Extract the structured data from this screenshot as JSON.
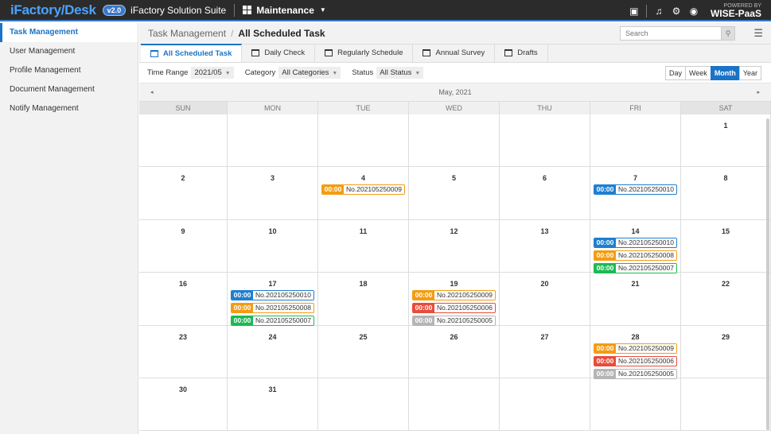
{
  "topbar": {
    "brand_part1": "iFactory",
    "brand_slash": "/",
    "brand_part2": "Desk",
    "version": "v2.0",
    "suite": "iFactory Solution Suite",
    "module": "Maintenance",
    "powered_by": "POWERED BY",
    "wise": "WISE-PaaS"
  },
  "sidebar": {
    "items": [
      {
        "label": "Task Management"
      },
      {
        "label": "User Management"
      },
      {
        "label": "Profile Management"
      },
      {
        "label": "Document Management"
      },
      {
        "label": "Notify Management"
      }
    ]
  },
  "breadcrumb": {
    "parent": "Task Management",
    "separator": "/",
    "current": "All Scheduled Task"
  },
  "search": {
    "placeholder": "Search"
  },
  "tabs": [
    {
      "label": "All Scheduled Task"
    },
    {
      "label": "Daily Check"
    },
    {
      "label": "Regularly Schedule"
    },
    {
      "label": "Annual Survey"
    },
    {
      "label": "Drafts"
    }
  ],
  "filters": {
    "time_range_label": "Time Range",
    "time_range_value": "2021/05",
    "category_label": "Category",
    "category_value": "All Categories",
    "status_label": "Status",
    "status_value": "All Status"
  },
  "views": [
    "Day",
    "Week",
    "Month",
    "Year"
  ],
  "calendar": {
    "month_label": "May, 2021",
    "prev_icon": "◂",
    "next_icon": "▸",
    "weekdays": [
      "SUN",
      "MON",
      "TUE",
      "WED",
      "THU",
      "FRI",
      "SAT"
    ],
    "colors": {
      "blue": "#1e7fd0",
      "orange": "#f39c12",
      "green": "#1db954",
      "red": "#e74c3c",
      "gray": "#b5b5b5"
    },
    "weeks": [
      [
        {
          "day": ""
        },
        {
          "day": ""
        },
        {
          "day": ""
        },
        {
          "day": ""
        },
        {
          "day": ""
        },
        {
          "day": ""
        },
        {
          "day": "1"
        }
      ],
      [
        {
          "day": "2"
        },
        {
          "day": "3"
        },
        {
          "day": "4",
          "events": [
            {
              "time": "00:00",
              "no": "No.202105250009",
              "color": "orange"
            }
          ]
        },
        {
          "day": "5"
        },
        {
          "day": "6"
        },
        {
          "day": "7",
          "events": [
            {
              "time": "00:00",
              "no": "No.202105250010",
              "color": "blue"
            }
          ]
        },
        {
          "day": "8"
        }
      ],
      [
        {
          "day": "9"
        },
        {
          "day": "10"
        },
        {
          "day": "11"
        },
        {
          "day": "12"
        },
        {
          "day": "13"
        },
        {
          "day": "14",
          "events": [
            {
              "time": "00:00",
              "no": "No.202105250010",
              "color": "blue"
            },
            {
              "time": "00:00",
              "no": "No.202105250008",
              "color": "orange"
            },
            {
              "time": "00:00",
              "no": "No.202105250007",
              "color": "green"
            }
          ]
        },
        {
          "day": "15"
        }
      ],
      [
        {
          "day": "16"
        },
        {
          "day": "17",
          "events": [
            {
              "time": "00:00",
              "no": "No.202105250010",
              "color": "blue"
            },
            {
              "time": "00:00",
              "no": "No.202105250008",
              "color": "orange"
            },
            {
              "time": "00:00",
              "no": "No.202105250007",
              "color": "green"
            }
          ]
        },
        {
          "day": "18"
        },
        {
          "day": "19",
          "events": [
            {
              "time": "00:00",
              "no": "No.202105250009",
              "color": "orange"
            },
            {
              "time": "00:00",
              "no": "No.202105250006",
              "color": "red"
            },
            {
              "time": "00:00",
              "no": "No.202105250005",
              "color": "gray"
            }
          ]
        },
        {
          "day": "20"
        },
        {
          "day": "21"
        },
        {
          "day": "22"
        }
      ],
      [
        {
          "day": "23"
        },
        {
          "day": "24"
        },
        {
          "day": "25"
        },
        {
          "day": "26"
        },
        {
          "day": "27"
        },
        {
          "day": "28",
          "events": [
            {
              "time": "00:00",
              "no": "No.202105250009",
              "color": "orange"
            },
            {
              "time": "00:00",
              "no": "No.202105250006",
              "color": "red"
            },
            {
              "time": "00:00",
              "no": "No.202105250005",
              "color": "gray"
            }
          ]
        },
        {
          "day": "29"
        }
      ],
      [
        {
          "day": "30"
        },
        {
          "day": "31"
        },
        {
          "day": ""
        },
        {
          "day": ""
        },
        {
          "day": ""
        },
        {
          "day": ""
        },
        {
          "day": ""
        }
      ]
    ]
  }
}
